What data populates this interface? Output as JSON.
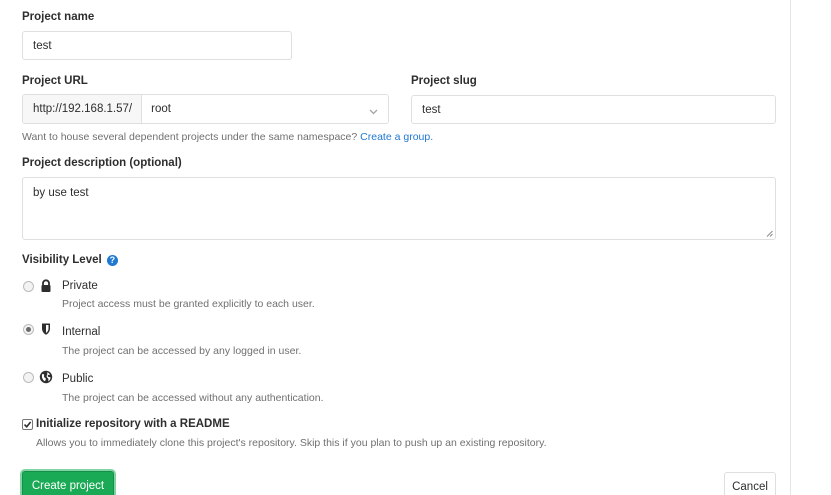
{
  "form": {
    "project_name_label": "Project name",
    "project_name_value": "test",
    "project_url_label": "Project URL",
    "url_prefix": "http://192.168.1.57/",
    "namespace_selected": "root",
    "project_slug_label": "Project slug",
    "project_slug_value": "test",
    "namespace_help_text": "Want to house several dependent projects under the same namespace?",
    "create_group_link": "Create a group.",
    "description_label": "Project description (optional)",
    "description_value": "by use test"
  },
  "visibility": {
    "label": "Visibility Level",
    "help_icon": "question-circle-icon",
    "options": [
      {
        "title": "Private",
        "description": "Project access must be granted explicitly to each user.",
        "icon": "lock-icon",
        "checked": false
      },
      {
        "title": "Internal",
        "description": "The project can be accessed by any logged in user.",
        "icon": "shield-icon",
        "checked": true
      },
      {
        "title": "Public",
        "description": "The project can be accessed without any authentication.",
        "icon": "globe-icon",
        "checked": false
      }
    ]
  },
  "readme": {
    "label": "Initialize repository with a README",
    "description": "Allows you to immediately clone this project's repository. Skip this if you plan to push up an existing repository.",
    "checked": true
  },
  "actions": {
    "create_label": "Create project",
    "cancel_label": "Cancel"
  },
  "colors": {
    "primary_button": "#1aaa55",
    "link": "#1f78d1"
  }
}
